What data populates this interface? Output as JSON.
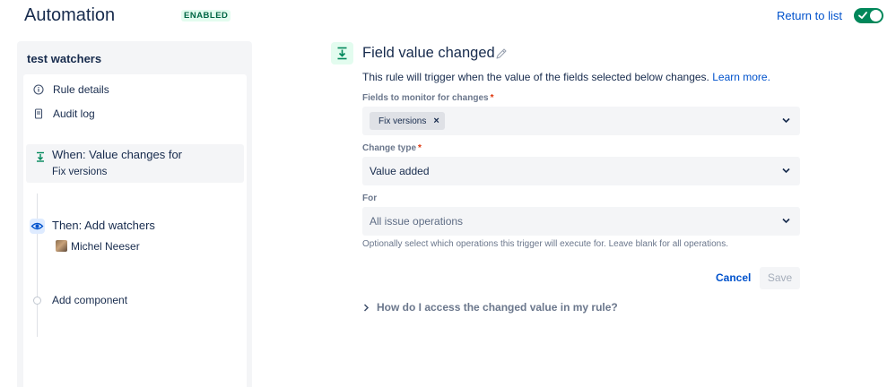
{
  "header": {
    "title": "Automation",
    "status_badge": "ENABLED",
    "return_link": "Return to list",
    "enabled": true
  },
  "sidebar": {
    "rule_name": "test watchers",
    "nav_items": [
      {
        "label": "Rule details",
        "icon": "info-icon"
      },
      {
        "label": "Audit log",
        "icon": "document-icon"
      }
    ],
    "trigger": {
      "title": "When: Value changes for",
      "subtitle": "Fix versions",
      "icon": "field-trigger-icon"
    },
    "action": {
      "title": "Then: Add watchers",
      "user": "Michel Neeser",
      "icon": "eye-icon"
    },
    "add_component": "Add component"
  },
  "main": {
    "title": "Field value changed",
    "description": "This rule will trigger when the value of the fields selected below changes.",
    "learn_more": "Learn more.",
    "fields_label": "Fields to monitor for changes",
    "fields_selected": [
      "Fix versions"
    ],
    "change_type_label": "Change type",
    "change_type_value": "Value added",
    "for_label": "For",
    "for_placeholder": "All issue operations",
    "for_help": "Optionally select which operations this trigger will execute for. Leave blank for all operations.",
    "cancel": "Cancel",
    "save": "Save",
    "faq": "How do I access the changed value in my rule?"
  },
  "colors": {
    "brand_link": "#0052cc",
    "enabled_green": "#00875a",
    "required": "#de350b"
  }
}
